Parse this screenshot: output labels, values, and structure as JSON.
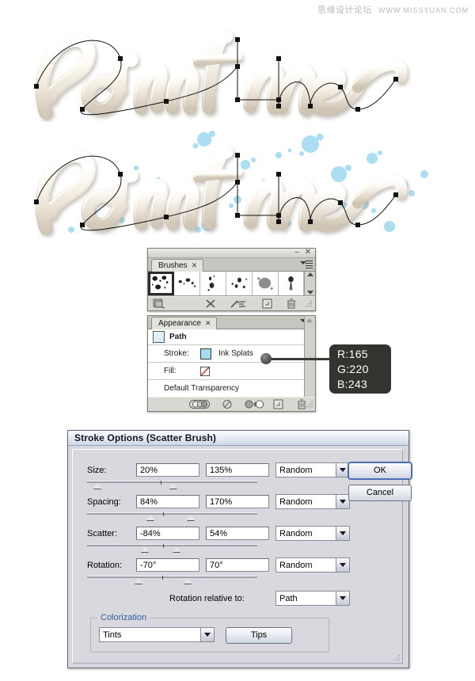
{
  "watermark": {
    "cn": "思缘设计论坛",
    "url": "WWW.MISSYUAN.COM"
  },
  "artwork": {
    "text": "Paint me",
    "letter_fill": "#efe9df",
    "path_color": "#1a1a1a",
    "splatter_color": "#a5dcf3"
  },
  "brushes_panel": {
    "tab_label": "Brushes",
    "tab_close": "✕",
    "minimize": "–",
    "close": "✕",
    "brushes": [
      {
        "name": "ink-splats-brush-1",
        "selected": true
      },
      {
        "name": "ink-splats-brush-2",
        "selected": false
      },
      {
        "name": "ink-splats-brush-3",
        "selected": false
      },
      {
        "name": "ink-splats-brush-4",
        "selected": false
      },
      {
        "name": "ink-blot-brush-5",
        "selected": false
      },
      {
        "name": "ink-drop-brush-6",
        "selected": false
      }
    ],
    "tools": [
      "brush-libraries-icon",
      "remove-brush-stroke-icon",
      "brush-options-icon",
      "new-brush-icon",
      "delete-brush-icon"
    ]
  },
  "appearance_panel": {
    "tab_label": "Appearance",
    "tab_close": "✕",
    "rows": [
      {
        "label": "Path",
        "type": "header"
      },
      {
        "label": "Stroke:",
        "value": "Ink Splats",
        "swatch": "#a5dcf3"
      },
      {
        "label": "Fill:",
        "value": "",
        "swatch": "none"
      },
      {
        "label": "Default Transparency",
        "value": ""
      }
    ],
    "tools": [
      "new-art-has-basic-appearance-icon",
      "clear-appearance-icon",
      "reduce-to-basic-appearance-icon",
      "duplicate-item-icon",
      "delete-item-icon"
    ]
  },
  "color_callout": {
    "r_label": "R:",
    "r_value": "165",
    "g_label": "G:",
    "g_value": "220",
    "b_label": "B:",
    "b_value": "243",
    "hex": "#a5dcf3"
  },
  "dialog": {
    "title": "Stroke Options (Scatter Brush)",
    "rows": [
      {
        "label": "Size:",
        "min": "20%",
        "max": "135%",
        "mode": "Random",
        "slider_a": 6,
        "slider_b": 48,
        "mark": 43
      },
      {
        "label": "Spacing:",
        "min": "84%",
        "max": "170%",
        "mode": "Random",
        "slider_a": 38,
        "slider_b": 63,
        "mark": 45
      },
      {
        "label": "Scatter:",
        "min": "-84%",
        "max": "54%",
        "mode": "Random",
        "slider_a": 35,
        "slider_b": 52,
        "mark": 45
      },
      {
        "label": "Rotation:",
        "min": "-70°",
        "max": "70°",
        "mode": "Random",
        "slider_a": 30,
        "slider_b": 69,
        "mark": 50
      }
    ],
    "rotation_relative_label": "Rotation relative to:",
    "rotation_relative_value": "Path",
    "colorization_title": "Colorization",
    "colorization_value": "Tints",
    "tips_label": "Tips",
    "ok_label": "OK",
    "cancel_label": "Cancel"
  }
}
